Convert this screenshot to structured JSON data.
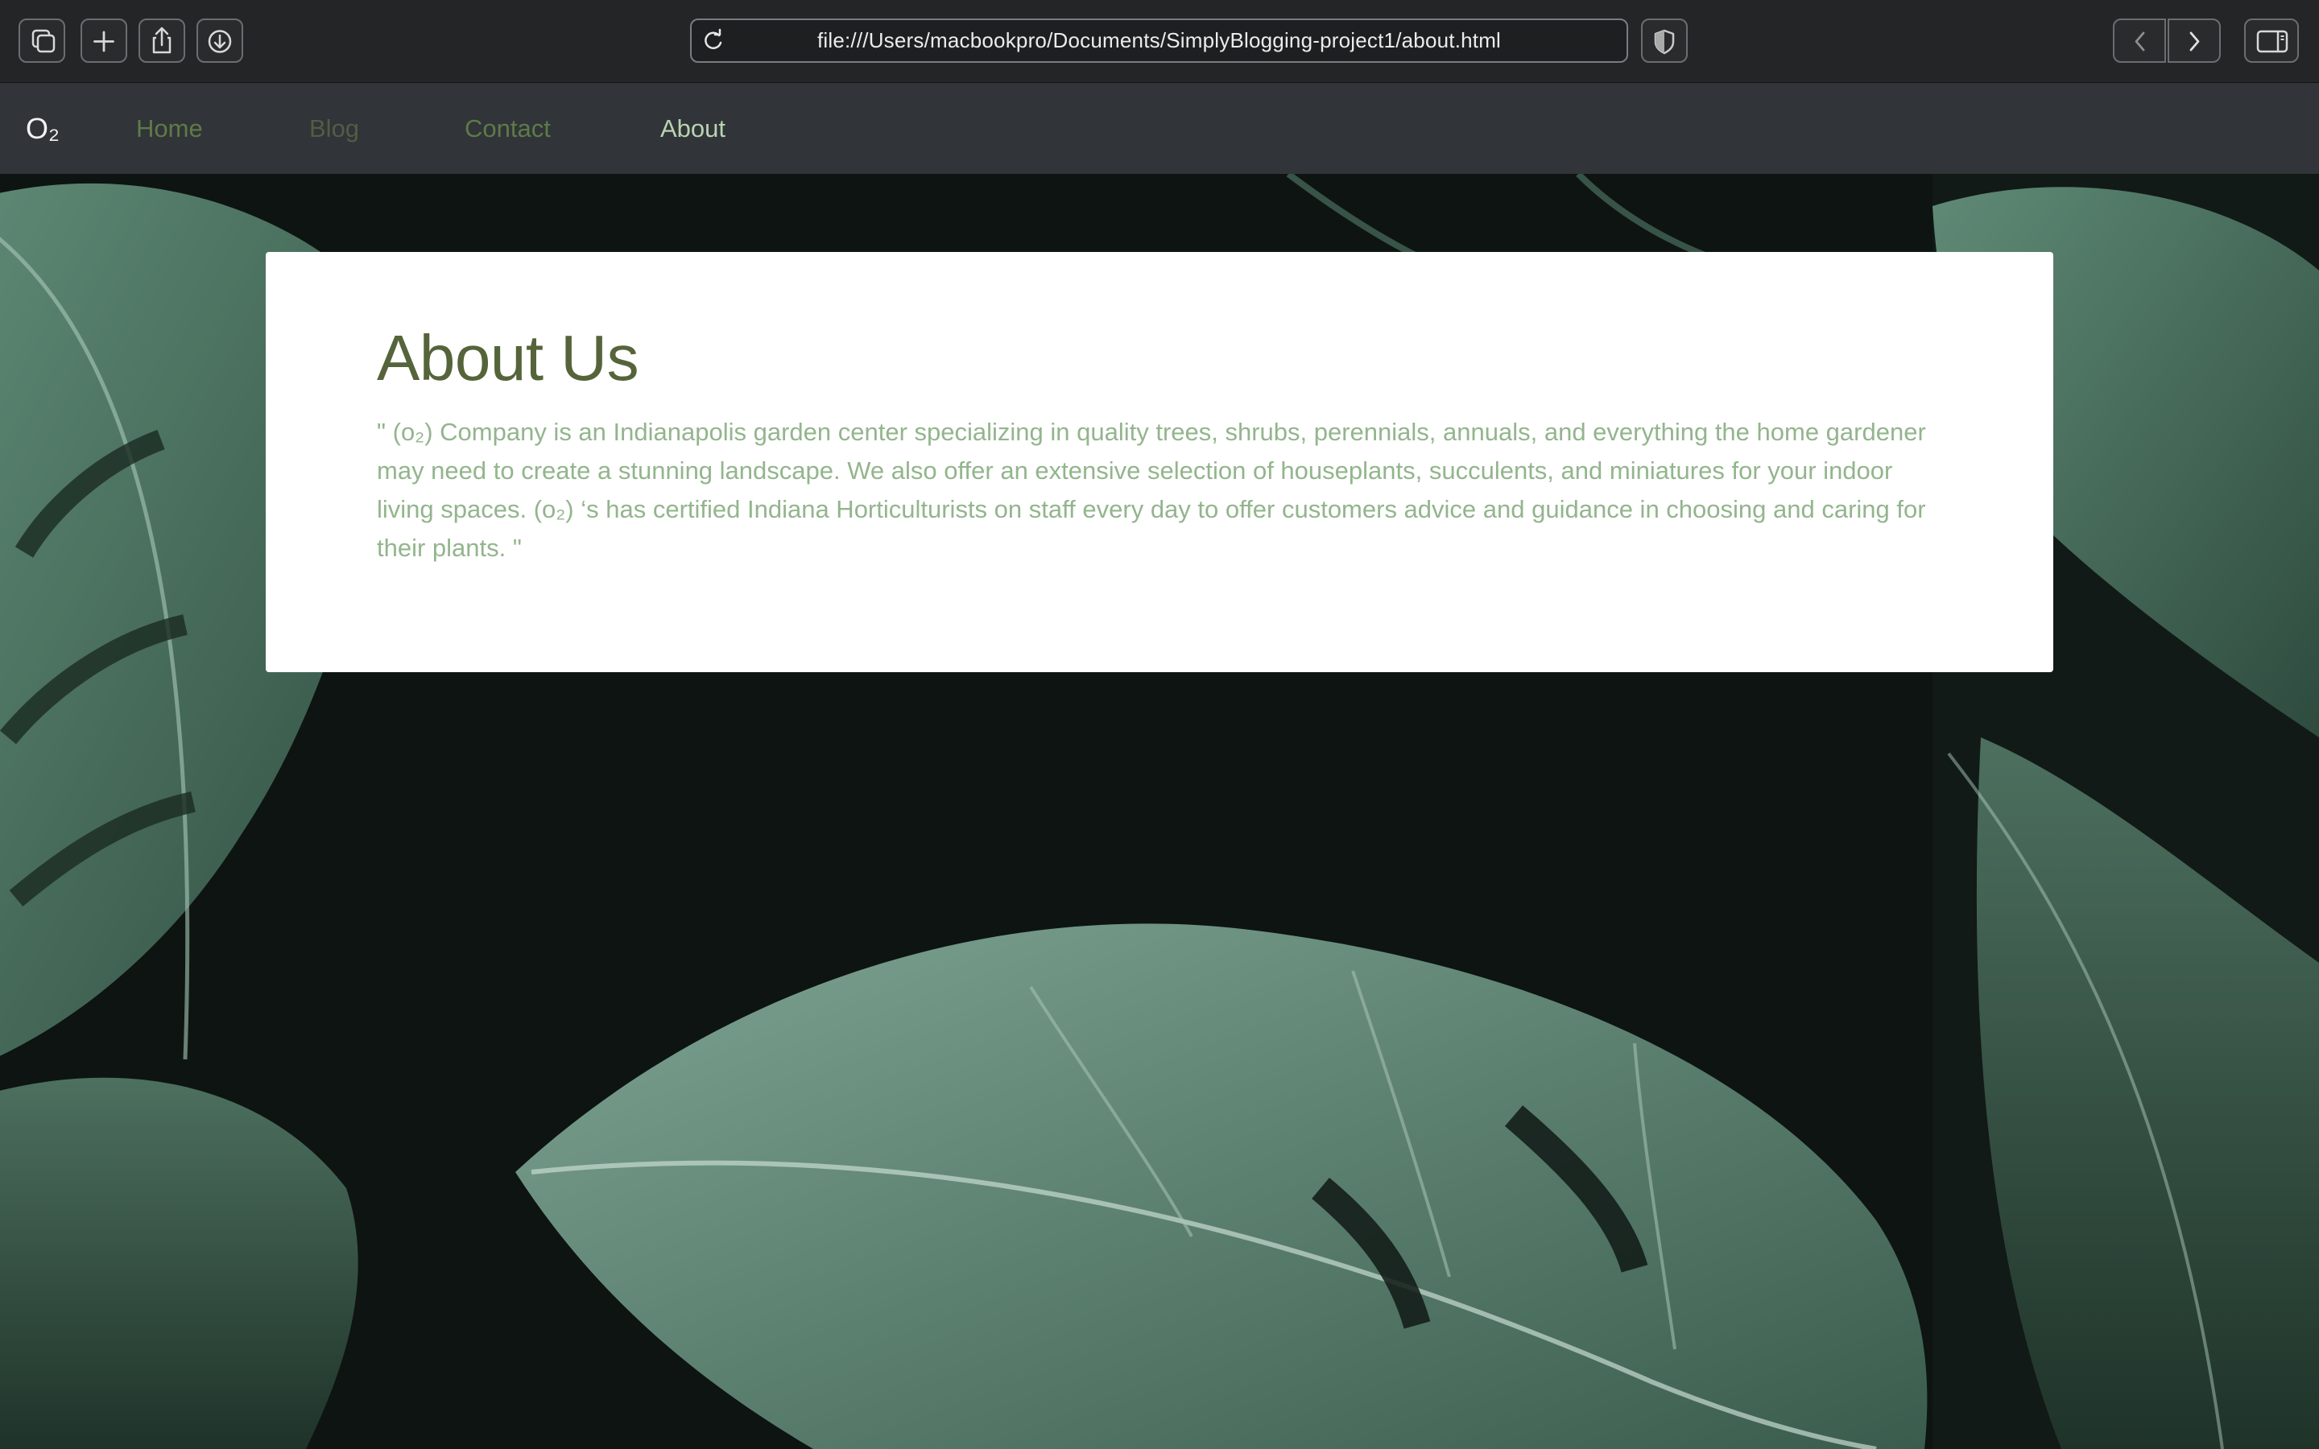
{
  "browser": {
    "url": "file:///Users/macbookpro/Documents/SimplyBlogging-project1/about.html",
    "buttons": [
      "tabs-overview-icon",
      "new-tab-icon",
      "share-icon",
      "downloads-icon",
      "privacy-shield-icon",
      "back-icon",
      "forward-icon",
      "sidebar-icon"
    ]
  },
  "site": {
    "brand": "O₂",
    "nav": [
      {
        "label": "Home",
        "color": "#5f7a48"
      },
      {
        "label": "Blog",
        "color": "#545c44"
      },
      {
        "label": "Contact",
        "color": "#5e7a49"
      },
      {
        "label": "About",
        "color": "#b9d3b1"
      }
    ]
  },
  "about": {
    "heading": "About Us",
    "body": "\" (o₂) Company is an Indianapolis garden center specializing in quality trees, shrubs, perennials, annuals, and everything the home gardener may need to create a stunning landscape. We also offer an extensive selection of houseplants, succulents, and miniatures for your indoor living spaces. (o₂) ‘s has certified Indiana Horticulturists on staff every day to offer customers advice and guidance in choosing and caring for their plants. \""
  },
  "colors": {
    "heading": "#55643a",
    "body_text": "#93b58d",
    "navbar": "#313438"
  }
}
